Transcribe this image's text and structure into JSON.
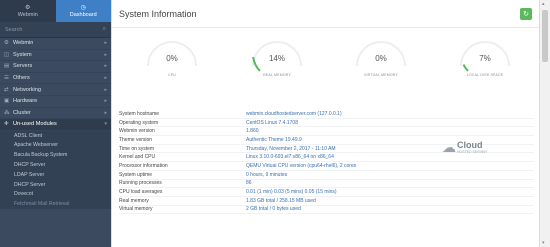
{
  "sidebar": {
    "tabs": [
      {
        "icon": "webmin-icon",
        "label": "Webmin",
        "active": false
      },
      {
        "icon": "dashboard-icon",
        "label": "Dashboard",
        "active": true
      }
    ],
    "search_placeholder": "Search",
    "menu": [
      {
        "icon": "webmin-icon",
        "label": "Webmin"
      },
      {
        "icon": "system-icon",
        "label": "System"
      },
      {
        "icon": "servers-icon",
        "label": "Servers"
      },
      {
        "icon": "others-icon",
        "label": "Others"
      },
      {
        "icon": "networking-icon",
        "label": "Networking"
      },
      {
        "icon": "hardware-icon",
        "label": "Hardware"
      },
      {
        "icon": "cluster-icon",
        "label": "Cluster"
      },
      {
        "icon": "unused-modules-icon",
        "label": "Un-used Modules"
      }
    ],
    "submenu": [
      "ADSL Client",
      "Apache Webserver",
      "Bacula Backup System",
      "DHCP Server",
      "LDAP Server",
      "DHCP Server",
      "Dovecot",
      "Fetchmail Mail Retrieval"
    ]
  },
  "header": {
    "title": "System Information",
    "refresh_icon": "refresh-icon"
  },
  "gauges": [
    {
      "value": "0%",
      "caption": "CPU",
      "fraction": 0
    },
    {
      "value": "14%",
      "caption": "REAL MEMORY",
      "fraction": 0.14
    },
    {
      "value": "0%",
      "caption": "VIRTUAL MEMORY",
      "fraction": 0
    },
    {
      "value": "7%",
      "caption": "LOCAL DISK SPACE",
      "fraction": 0.07
    }
  ],
  "info": [
    {
      "key": "System hostname",
      "value": "webmin.cloudhostedserver.com (127.0.0.1)"
    },
    {
      "key": "Operating system",
      "value": "CentOS Linux 7.4.1708"
    },
    {
      "key": "Webmin version",
      "value": "1.860"
    },
    {
      "key": "Theme version",
      "value": "Authentic Theme 19.49.9"
    },
    {
      "key": "Time on system",
      "value": "Thursday, November 2, 2017 - 11:10 AM"
    },
    {
      "key": "Kernel and CPU",
      "value": "Linux 3.10.0-693.el7.x86_64 on x86_64"
    },
    {
      "key": "Processor information",
      "value": "QEMU Virtual CPU version (cpu64-rhel6), 2 cores"
    },
    {
      "key": "System uptime",
      "value": "0 hours, 9 minutes"
    },
    {
      "key": "Running processes",
      "value": "86"
    },
    {
      "key": "CPU load averages",
      "value": "0.01 (1 min) 0.03 (5 mins) 0.05 (15 mins)"
    },
    {
      "key": "Real memory",
      "value": "1.83 GB total / 258.15 MB used"
    },
    {
      "key": "Virtual memory",
      "value": "2 GB total / 0 bytes used"
    }
  ],
  "logo": {
    "icon": "cloud-icon",
    "brand": "Cloud",
    "tagline": "HOSTED SERVER"
  },
  "colors": {
    "sidebar": "#3b4a5e",
    "accent": "#3f7fc6",
    "gauge": "#5cb85c",
    "link": "#3a6fb0"
  }
}
